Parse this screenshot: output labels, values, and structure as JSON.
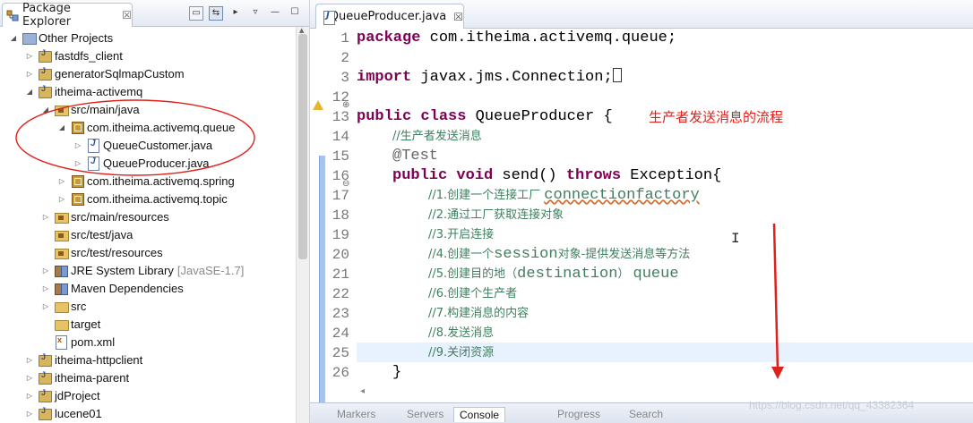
{
  "package_explorer": {
    "tab_label": "Package Explorer",
    "close_glyph": "☒",
    "tree": [
      {
        "label": "Other Projects",
        "icon": "working-set-icon",
        "twisty": "open"
      },
      {
        "label": "fastdfs_client",
        "icon": "project-icon",
        "twisty": "closed"
      },
      {
        "label": "generatorSqlmapCustom",
        "icon": "project-icon",
        "twisty": "closed"
      },
      {
        "label": "itheima-activemq",
        "icon": "project-icon",
        "twisty": "open"
      },
      {
        "label": "src/main/java",
        "icon": "source-folder-icon",
        "twisty": "open"
      },
      {
        "label": "com.itheima.activemq.queue",
        "icon": "package-icon",
        "twisty": "open"
      },
      {
        "label": "QueueCustomer.java",
        "icon": "java-file-icon",
        "twisty": "closed"
      },
      {
        "label": "QueueProducer.java",
        "icon": "java-file-icon",
        "twisty": "closed"
      },
      {
        "label": "com.itheima.activemq.spring",
        "icon": "package-icon",
        "twisty": "closed"
      },
      {
        "label": "com.itheima.activemq.topic",
        "icon": "package-icon",
        "twisty": "closed"
      },
      {
        "label": "src/main/resources",
        "icon": "source-folder-icon",
        "twisty": "closed"
      },
      {
        "label": "src/test/java",
        "icon": "source-folder-icon",
        "twisty": "none"
      },
      {
        "label": "src/test/resources",
        "icon": "source-folder-icon",
        "twisty": "none"
      },
      {
        "label": "JRE System Library",
        "suffix": "[JavaSE-1.7]",
        "icon": "library-icon",
        "twisty": "closed"
      },
      {
        "label": "Maven Dependencies",
        "icon": "library-icon",
        "twisty": "closed"
      },
      {
        "label": "src",
        "icon": "folder-icon",
        "twisty": "closed"
      },
      {
        "label": "target",
        "icon": "folder-icon",
        "twisty": "none"
      },
      {
        "label": "pom.xml",
        "icon": "xml-file-icon",
        "twisty": "none"
      },
      {
        "label": "itheima-httpclient",
        "icon": "project-icon",
        "twisty": "closed"
      },
      {
        "label": "itheima-parent",
        "icon": "project-icon",
        "twisty": "closed"
      },
      {
        "label": "jdProject",
        "icon": "project-icon",
        "twisty": "closed"
      },
      {
        "label": "lucene01",
        "icon": "project-icon",
        "twisty": "closed"
      }
    ]
  },
  "editor": {
    "tab_label": "QueueProducer.java",
    "close_glyph": "☒",
    "line_numbers": [
      "1",
      "2",
      "3",
      "12",
      "13",
      "14",
      "15",
      "16",
      "17",
      "18",
      "19",
      "20",
      "21",
      "22",
      "23",
      "24",
      "25",
      "26"
    ],
    "code": {
      "l1_kw": "package",
      "l1_rest": " com.itheima.activemq.queue;",
      "l3_kw": "import",
      "l3_rest": " javax.jms.Connection;",
      "l13_kw": "public class",
      "l13_rest": " QueueProducer {",
      "l14": "//生产者发送消息",
      "l15": "@Test",
      "l16_kw1": "public void",
      "l16_mid": " send() ",
      "l16_kw2": "throws",
      "l16_rest": " Exception{",
      "l17_a": "//1.创建一个连接工厂 ",
      "l17_b": "connectionfactory",
      "l18": "//2.通过工厂获取连接对象",
      "l19": "//3.开启连接",
      "l20_a": "//4.创建一个",
      "l20_b": "session",
      "l20_c": "对象-提供发送消息等方法",
      "l21_a": "//5.创建目的地（",
      "l21_b": "destination",
      "l21_c": "） ",
      "l21_d": "queue",
      "l22": "//6.创建个生产者",
      "l23": "//7.构建消息的内容",
      "l24": "//8.发送消息",
      "l25": "//9.关闭资源",
      "l26": "}"
    },
    "annotation_text": "生产者发送消息的流程",
    "cursor_glyph": "I"
  },
  "bottom_tabs": [
    "Markers",
    "Servers",
    "Console",
    "Progress",
    "Search"
  ],
  "bottom_active": "Console",
  "watermark": "https://blog.csdn.net/qq_43382364",
  "colors": {
    "keyword": "#7f0055",
    "comment": "#3f7f5f",
    "annotation_red": "#e0201a",
    "current_line": "#e8f2fe"
  }
}
